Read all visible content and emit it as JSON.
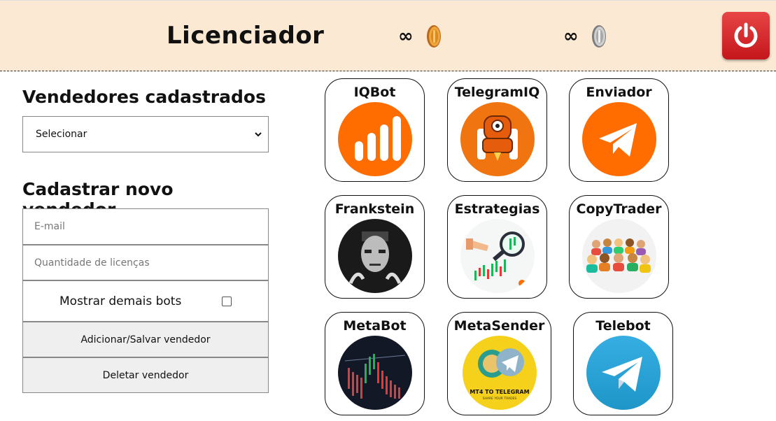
{
  "header": {
    "title": "Licenciador",
    "gold_credits": "∞",
    "silver_credits": "∞",
    "power_icon": "power-icon",
    "accent": "#e02b2b"
  },
  "sellers": {
    "title": "Vendedores cadastrados",
    "select_value": "Selecionar"
  },
  "new_seller": {
    "title": "Cadastrar novo vendedor",
    "email_placeholder": "E-mail",
    "licenses_placeholder": "Quantidade de licenças",
    "show_bots_label": "Mostrar demais bots",
    "save_button": "Adicionar/Salvar vendedor",
    "delete_button": "Deletar vendedor"
  },
  "bots": [
    {
      "name": "IQBot",
      "icon": "iqbot-bars-icon"
    },
    {
      "name": "TelegramIQ",
      "icon": "telegramiq-robot-icon"
    },
    {
      "name": "Enviador",
      "icon": "paper-plane-icon"
    },
    {
      "name": "Frankstein",
      "icon": "frankenstein-portrait"
    },
    {
      "name": "Estrategias",
      "icon": "magnifier-chart-icon"
    },
    {
      "name": "CopyTrader",
      "icon": "crowd-icon"
    },
    {
      "name": "MetaBot",
      "icon": "candlestick-chart-icon"
    },
    {
      "name": "MetaSender",
      "icon": "mt4-telegram-icon",
      "logo_text": "MT4 TO TELEGRAM",
      "logo_subtext": "SHARE YOUR TRADES"
    },
    {
      "name": "Telebot",
      "icon": "telegram-icon"
    }
  ]
}
